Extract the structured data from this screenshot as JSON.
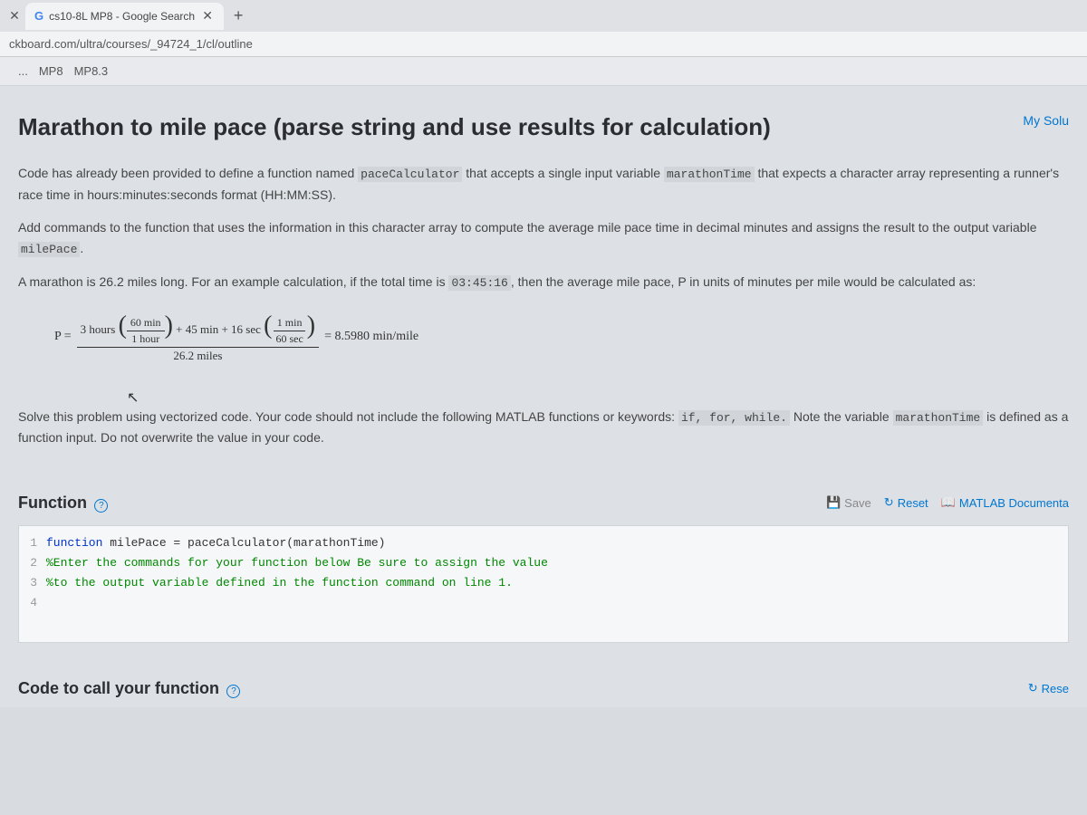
{
  "browser": {
    "tab_title": "cs10-8L MP8 - Google Search",
    "url": "ckboard.com/ultra/courses/_94724_1/cl/outline"
  },
  "breadcrumb": {
    "item1": "MP8",
    "item2": "MP8.3"
  },
  "page": {
    "title": "Marathon to mile pace (parse string and use results for calculation)",
    "my_solutions": "My Solu"
  },
  "desc": {
    "p1a": "Code has already been provided to define a function named ",
    "p1_code1": "paceCalculator",
    "p1b": " that accepts a single input variable ",
    "p1_code2": "marathonTime",
    "p1c": " that expects a character array representing a runner's race time in hours:minutes:seconds format (HH:MM:SS).",
    "p2a": "Add commands to the function that uses the information in this character array to compute the average mile pace time in decimal minutes and assigns the result to the output variable ",
    "p2_code": "milePace",
    "p2b": ".",
    "p3a": "A marathon is 26.2 miles long. For an example calculation, if the total time is ",
    "p3_code": "03:45:16",
    "p3b": ", then the average mile pace, P in units of minutes per mile would be calculated as:"
  },
  "formula": {
    "p_eq": "P =",
    "three_hours": "3 hours",
    "sixty_min": "60 min",
    "one_hour": "1 hour",
    "plus_45": " + 45 min + 16 sec",
    "one_min": "1 min",
    "sixty_sec": "60 sec",
    "denom": "26.2 miles",
    "result": "= 8.5980 min/mile"
  },
  "desc2": {
    "a": "Solve this problem using vectorized code. Your code should not include the following MATLAB functions or keywords: ",
    "kw": "if, for, while.",
    "b": "   Note the variable ",
    "var": "marathonTime",
    "c": " is defined as a function input. Do not overwrite the value in your code."
  },
  "sections": {
    "function_label": "Function",
    "call_label": "Code to call your function"
  },
  "toolbar": {
    "save": "Save",
    "reset": "Reset",
    "docs": "MATLAB Documenta",
    "reset2": "Rese"
  },
  "code": {
    "lines": [
      {
        "n": "1",
        "kw": "function ",
        "text1": "milePace = paceCalculator(marathonTime)"
      },
      {
        "n": "2",
        "com": "%Enter the commands for your function below Be sure to assign the value"
      },
      {
        "n": "3",
        "com": "%to the output variable defined in the function command on line 1."
      },
      {
        "n": "4",
        "text": ""
      }
    ]
  }
}
